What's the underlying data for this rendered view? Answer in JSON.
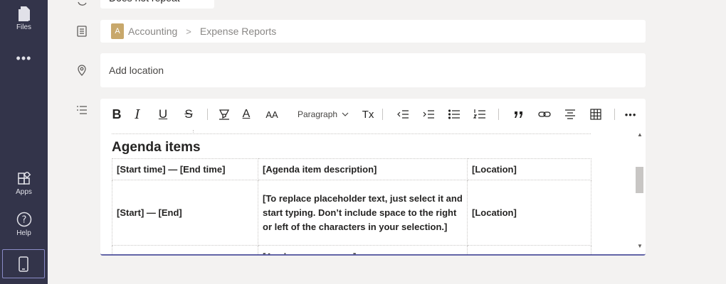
{
  "rail": {
    "files_label": "Files",
    "more_label": "•••",
    "apps_label": "Apps",
    "help_label": "Help"
  },
  "repeat": {
    "value": "Does not repeat"
  },
  "channel": {
    "team_initial": "A",
    "team": "Accounting",
    "separator": ">",
    "channel": "Expense Reports"
  },
  "location": {
    "placeholder": "Add location"
  },
  "toolbar": {
    "bold": "B",
    "italic": "I",
    "underline": "U",
    "strike": "S",
    "font_color": "A",
    "font_size": "AA",
    "paragraph": "Paragraph",
    "clear_format": "Tx",
    "more": "•••"
  },
  "doc": {
    "heading": "Agenda items",
    "rows": [
      [
        "[Start time] — [End time]",
        "[Agenda item description]",
        "[Location]"
      ],
      [
        "[Start] — [End]",
        "[To replace placeholder text, just select it and start typing. Don’t include space to the right or left of the characters in your selection.]",
        "[Location]"
      ],
      [
        "",
        "[Apply ... ... ... ... ... ...]",
        ""
      ]
    ]
  },
  "colors": {
    "rail": "#33344a",
    "accent": "#6264a7",
    "team_badge": "#c8a86b"
  }
}
